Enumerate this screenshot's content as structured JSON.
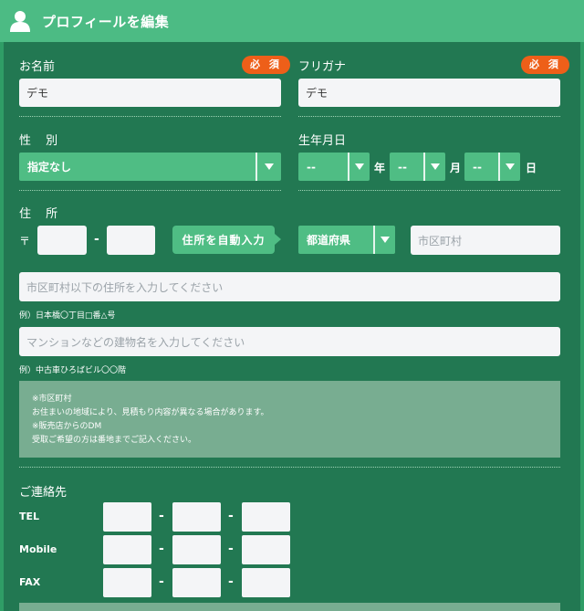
{
  "header": {
    "title": "プロフィールを編集",
    "icon": "user-icon"
  },
  "name": {
    "label": "お名前",
    "required": "必 須",
    "value": "デモ"
  },
  "furigana": {
    "label": "フリガナ",
    "required": "必 須",
    "value": "デモ"
  },
  "gender": {
    "label": "性 別",
    "selected": "指定なし"
  },
  "birth": {
    "label": "生年月日",
    "year": "--",
    "year_unit": "年",
    "month": "--",
    "month_unit": "月",
    "day": "--",
    "day_unit": "日"
  },
  "address": {
    "label": "住 所",
    "postal_mark": "〒",
    "postal_dash": "-",
    "auto_button": "住所を自動入力",
    "prefecture": "都道府県",
    "city_placeholder": "市区町村",
    "line1_placeholder": "市区町村以下の住所を入力してください",
    "line1_example": "例）日本橋〇丁目□番△号",
    "line2_placeholder": "マンションなどの建物名を入力してください",
    "line2_example": "例）中古車ひろばビル〇〇階",
    "notice_lines": [
      "※市区町村",
      "お住まいの地域により、見積もり内容が異なる場合があります。",
      "※販売店からのDM",
      "受取ご希望の方は番地までご記入ください。"
    ]
  },
  "contact": {
    "label": "ご連絡先",
    "rows": [
      {
        "label": "TEL",
        "dash": "-"
      },
      {
        "label": "Mobile",
        "dash": "-"
      },
      {
        "label": "FAX",
        "dash": "-"
      }
    ]
  },
  "colors": {
    "background": "#227852",
    "header": "#4cbb84",
    "accent_button": "#4fbd84",
    "required_badge": "#ee5f19",
    "notice_box": "#78ad91"
  }
}
